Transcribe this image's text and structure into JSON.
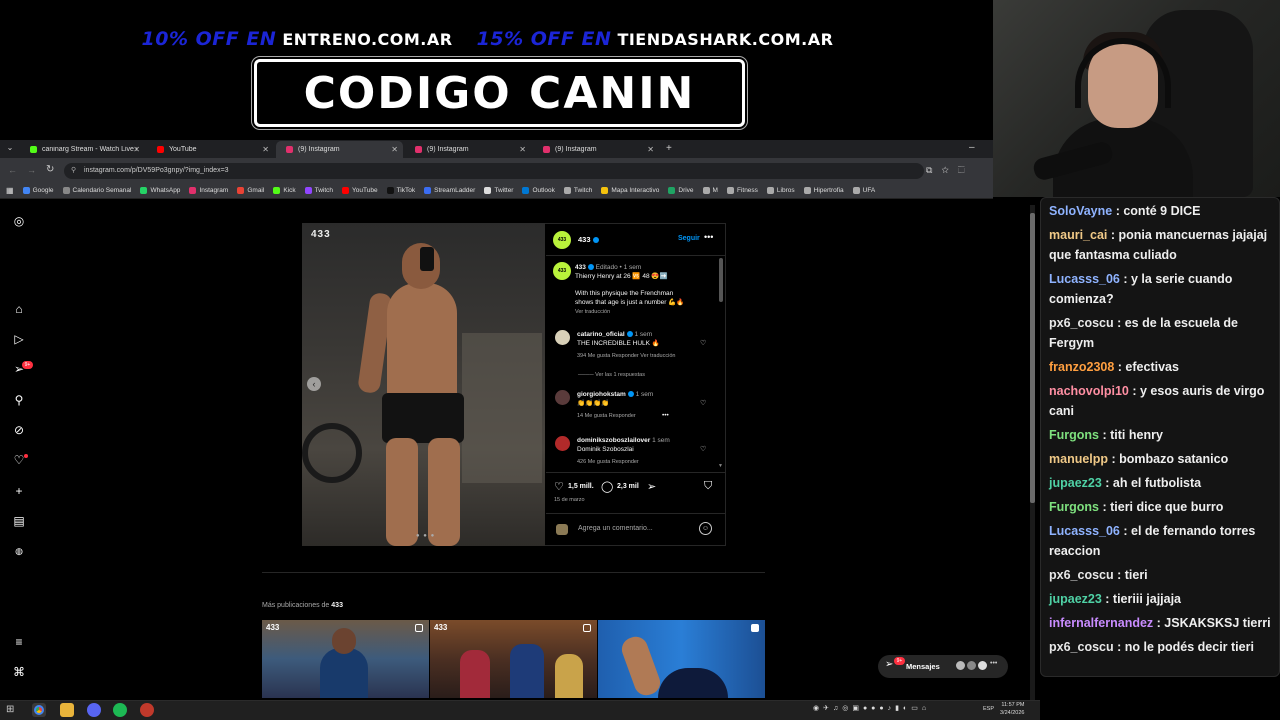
{
  "overlay": {
    "promo1_off": "10% OFF EN",
    "promo1_site": "ENTRENO.COM.AR",
    "promo2_off": "15% OFF EN",
    "promo2_site": "TIENDASHARK.COM.AR",
    "code": "CODIGO CANIN"
  },
  "browser": {
    "tabs": [
      {
        "label": "caninarg Stream - Watch Live o",
        "active": false,
        "color": "#53fc18"
      },
      {
        "label": "YouTube",
        "active": false,
        "color": "#ff0000"
      },
      {
        "label": "(9) Instagram",
        "active": true,
        "color": "#e1306c"
      },
      {
        "label": "(9) Instagram",
        "active": false,
        "color": "#e1306c"
      },
      {
        "label": "(9) Instagram",
        "active": false,
        "color": "#e1306c"
      }
    ],
    "url": "instagram.com/p/DV59Po3gnpy/?img_index=3",
    "bookmarks": [
      {
        "label": "Google",
        "color": "#4285f4"
      },
      {
        "label": "Calendario Semanal",
        "color": "#888888"
      },
      {
        "label": "WhatsApp",
        "color": "#25d366"
      },
      {
        "label": "Instagram",
        "color": "#e1306c"
      },
      {
        "label": "Gmail",
        "color": "#ea4335"
      },
      {
        "label": "Kick",
        "color": "#53fc18"
      },
      {
        "label": "Twitch",
        "color": "#9146ff"
      },
      {
        "label": "YouTube",
        "color": "#ff0000"
      },
      {
        "label": "TikTok",
        "color": "#111111"
      },
      {
        "label": "StreamLadder",
        "color": "#3b6df2"
      },
      {
        "label": "Twitter",
        "color": "#dddddd"
      },
      {
        "label": "Outlook",
        "color": "#0078d4"
      },
      {
        "label": "Twitch",
        "color": "#aaaaaa"
      },
      {
        "label": "Mapa Interactivo",
        "color": "#f4c20d"
      },
      {
        "label": "Drive",
        "color": "#1fa463"
      },
      {
        "label": "M",
        "color": "#aaaaaa"
      },
      {
        "label": "Fitness",
        "color": "#aaaaaa"
      },
      {
        "label": "Libros",
        "color": "#aaaaaa"
      },
      {
        "label": "Hipertrofia",
        "color": "#aaaaaa"
      },
      {
        "label": "UFA",
        "color": "#aaaaaa"
      }
    ]
  },
  "post": {
    "watermark": "433",
    "user": "433",
    "follow": "Seguir",
    "caption_user": "433",
    "caption_meta": "Editado • 1 sem",
    "caption_line1": "Thierry Henry at 26 🆚 48 😍➡️",
    "caption_line2": "With this physique the Frenchman",
    "caption_line3": "shows that age is just a number 💪🔥",
    "caption_translate": "Ver traducción",
    "comments": [
      {
        "user": "catarino_oficial",
        "time": "1 sem",
        "text": "THE INCREDIBLE HULK 🔥",
        "meta": "394 Me gusta   Responder   Ver traducción"
      },
      {
        "user": "giorgiohokstam",
        "time": "1 sem",
        "text": "👏👏👏👏",
        "meta": "14 Me gusta   Responder"
      },
      {
        "user": "dominikszoboszlailover",
        "time": "1 sem",
        "text": "Dominik Szoboszlai",
        "meta": "426 Me gusta   Responder"
      }
    ],
    "view_replies": "Ver las 1 respuestas",
    "likes": "1,5 mill.",
    "comments_count": "2,3 mil",
    "date": "15 de marzo",
    "add_comment": "Agrega un comentario...",
    "more_pubs_label": "Más publicaciones de",
    "more_pubs_user": "433",
    "messages": "Mensajes",
    "messages_badge": "9+",
    "sidebar_badge": "9+"
  },
  "chat": [
    {
      "user": "SoloVayne",
      "color": "#8fb3ff",
      "msg": "conté 9 DICE"
    },
    {
      "user": "mauri_cai",
      "color": "#f0c987",
      "msg": "ponia mancuernas jajajaj que fantasma culiado"
    },
    {
      "user": "Lucasss_06",
      "color": "#8fb3ff",
      "msg": "y la serie cuando comienza?"
    },
    {
      "user": "px6_coscu",
      "color": "#e8e8e8",
      "msg": "es de la escuela de Fergym"
    },
    {
      "user": "franzo2308",
      "color": "#ff9f40",
      "msg": "efectivas"
    },
    {
      "user": "nachovolpi10",
      "color": "#ff8fa3",
      "msg": "y esos auris de virgo cani"
    },
    {
      "user": "Furgons",
      "color": "#7ee07e",
      "msg": "titi henry"
    },
    {
      "user": "manuelpp",
      "color": "#f0c987",
      "msg": "bombazo satanico"
    },
    {
      "user": "jupaez23",
      "color": "#4fd1a5",
      "msg": "ah el futbolista"
    },
    {
      "user": "Furgons",
      "color": "#7ee07e",
      "msg": "tieri dice que burro"
    },
    {
      "user": "Lucasss_06",
      "color": "#8fb3ff",
      "msg": "el de fernando torres reaccion"
    },
    {
      "user": "px6_coscu",
      "color": "#e8e8e8",
      "msg": "tieri"
    },
    {
      "user": "jupaez23",
      "color": "#4fd1a5",
      "msg": "tieriii jajjaja"
    },
    {
      "user": "infernalfernandez",
      "color": "#c98cff",
      "msg": "JSKAKSKSJ tierri"
    },
    {
      "user": "px6_coscu",
      "color": "#e8e8e8",
      "msg": "no le podés decir tieri"
    }
  ],
  "taskbar": {
    "lang": "ESP",
    "time": "11:57 PM",
    "date": "3/24/2026"
  }
}
